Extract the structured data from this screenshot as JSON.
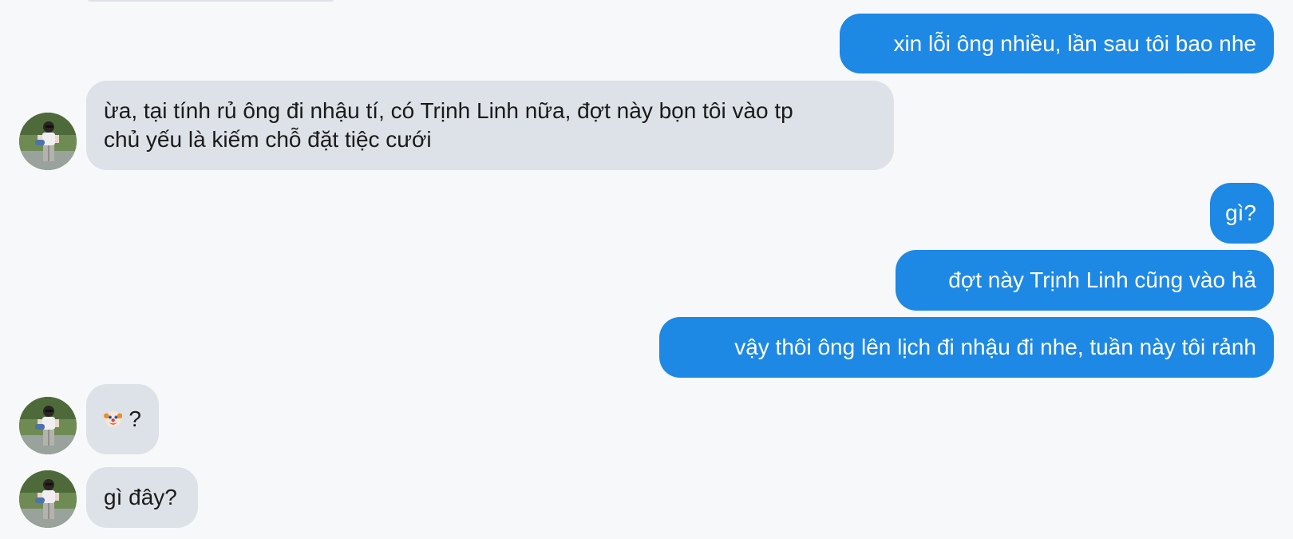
{
  "colors": {
    "background": "#f7f8f9",
    "outgoing_bubble": "#1e88e5",
    "incoming_bubble": "#dde2e8",
    "outgoing_text": "#ffffff",
    "incoming_text": "#1a1a1a"
  },
  "contact": {
    "avatar_icon": "profile-photo-avatar"
  },
  "messages": [
    {
      "direction": "out",
      "text": "xin lỗi ông nhiều, lần sau tôi bao nhe"
    },
    {
      "direction": "in",
      "lines": [
        "ừa, tại tính rủ ông đi nhậu tí, có Trịnh Linh nữa, đợt này bọn tôi vào tp",
        "chủ yếu là kiếm chỗ đặt tiệc cưới"
      ]
    },
    {
      "direction": "out",
      "text": "gì?"
    },
    {
      "direction": "out",
      "text": "đợt này Trịnh Linh cũng vào hả"
    },
    {
      "direction": "out",
      "text": "vậy thôi ông lên lịch đi nhậu đi nhe, tuần này tôi rảnh"
    },
    {
      "direction": "in",
      "emoji": "clown-face-emoji",
      "text": "?"
    },
    {
      "direction": "in",
      "text": "gì đây?"
    }
  ]
}
